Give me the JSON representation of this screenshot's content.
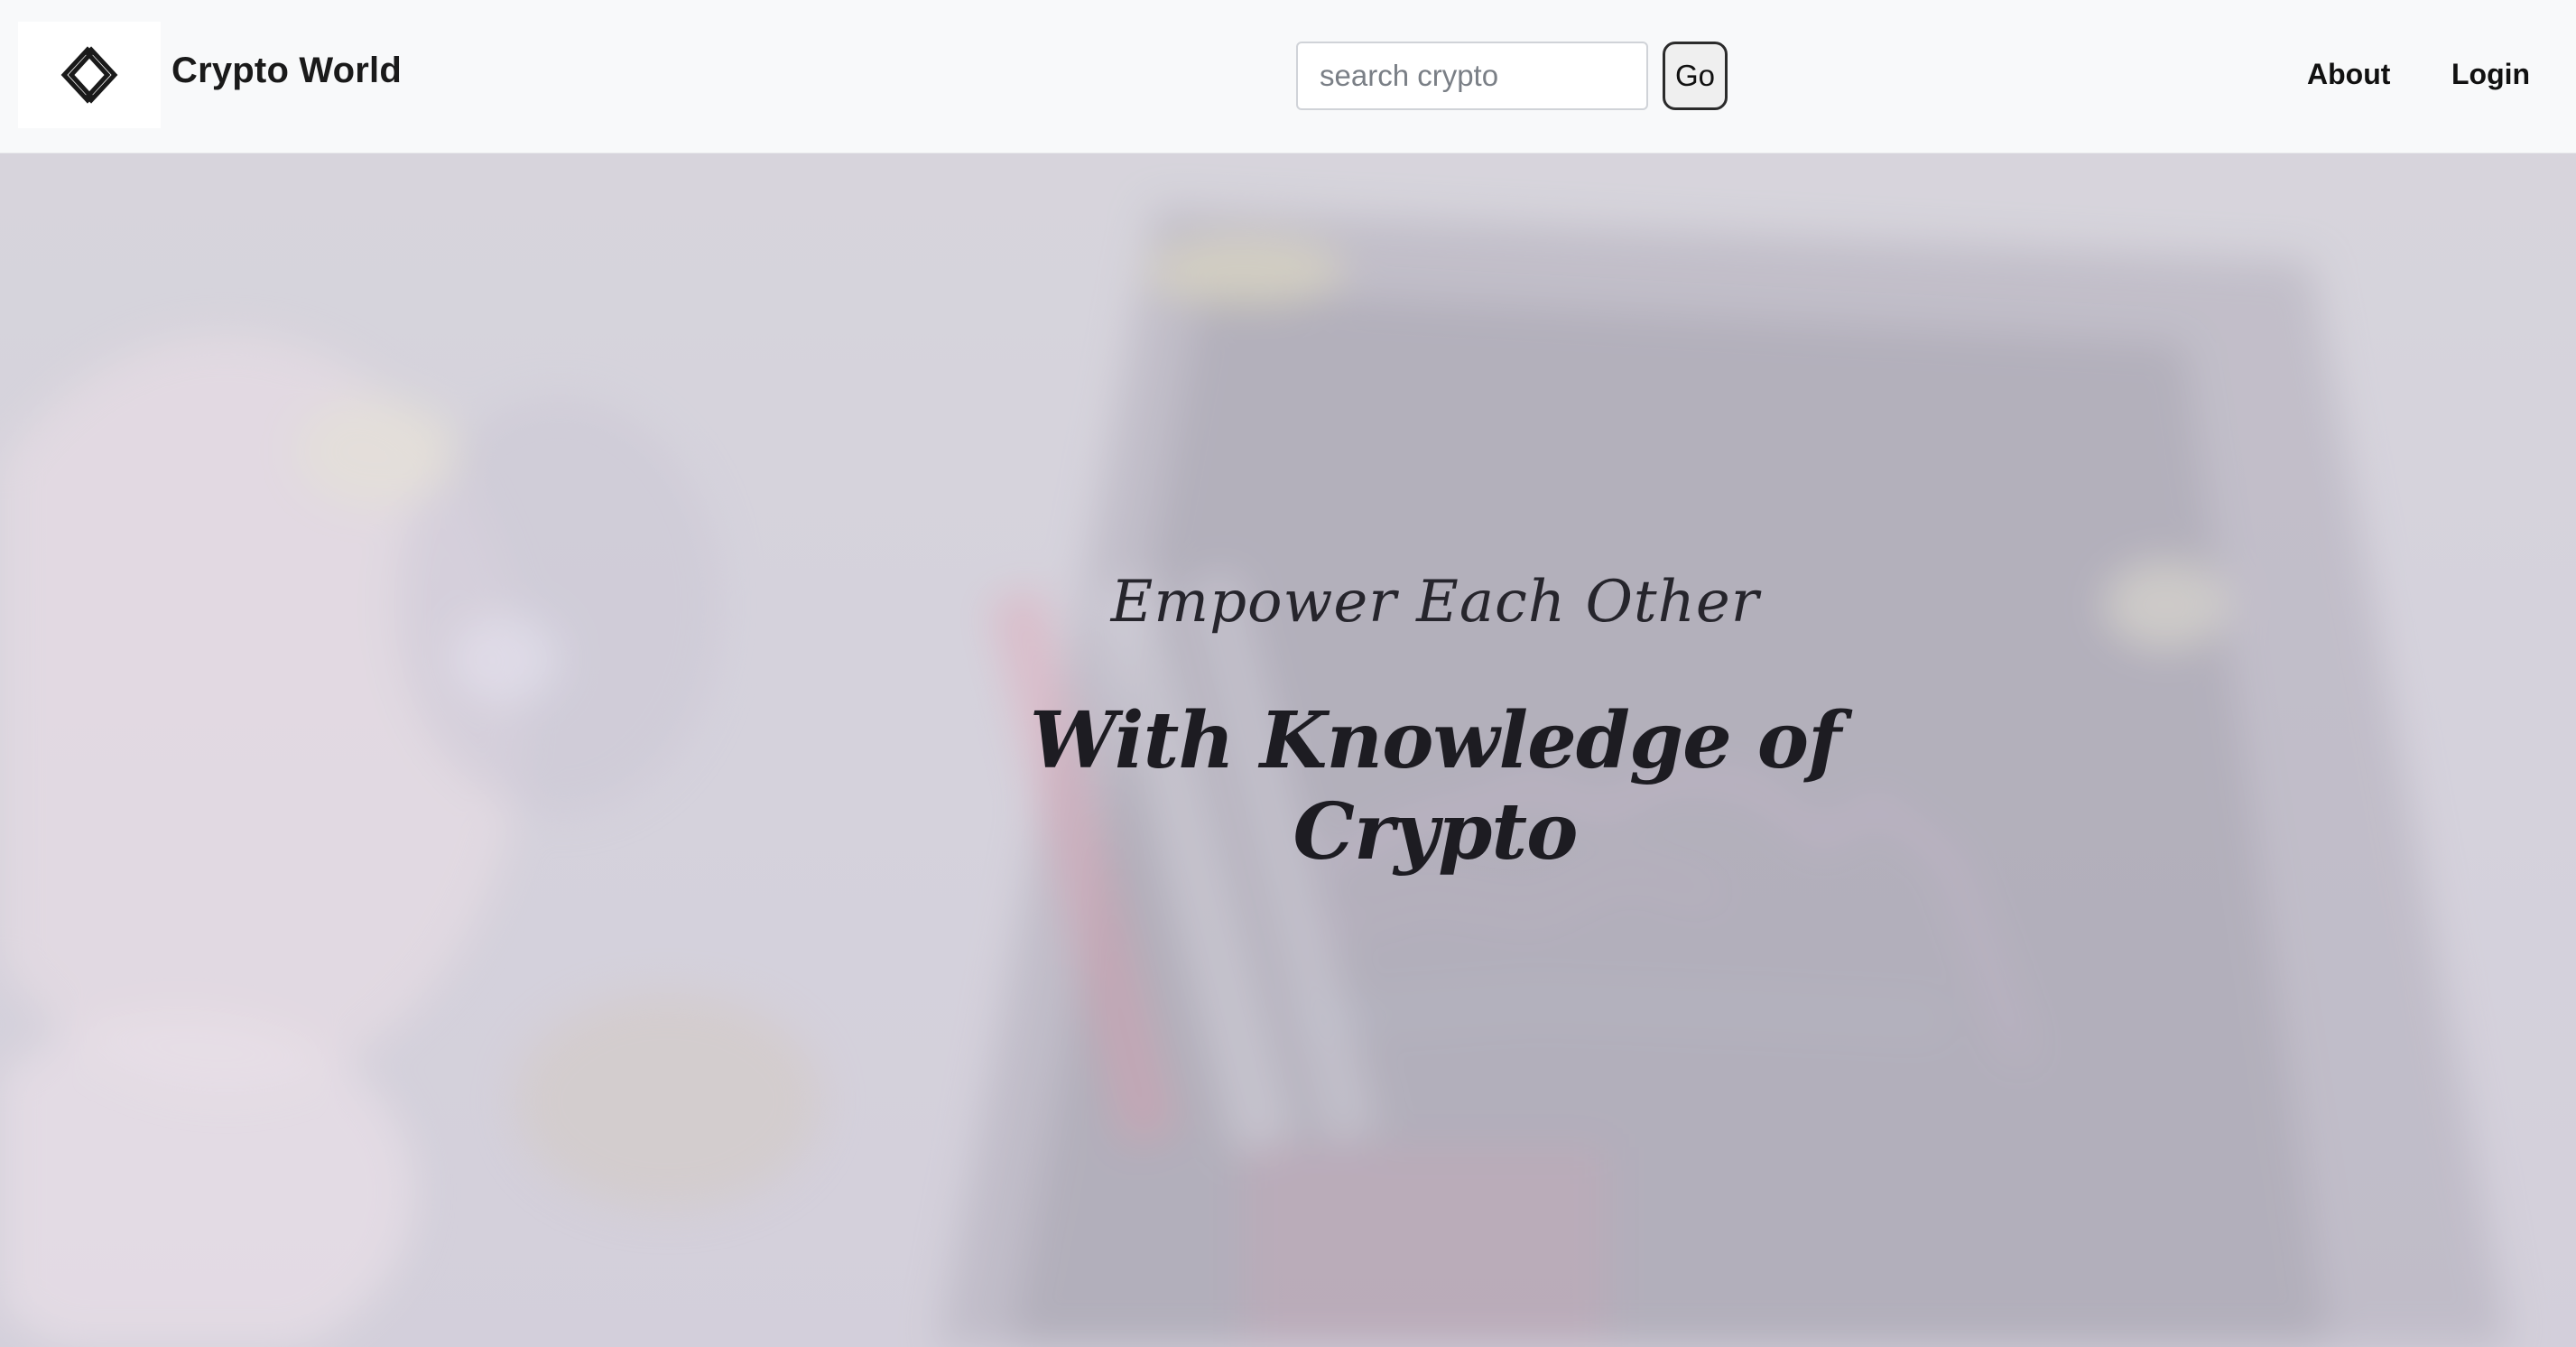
{
  "navbar": {
    "logo_icon": "diamond-logo-icon",
    "brand": "Crypto World",
    "search": {
      "placeholder": "search crypto",
      "value": ""
    },
    "go_label": "Go",
    "links": {
      "about": "About",
      "login": "Login"
    }
  },
  "hero": {
    "subtitle": "Empower Each Other",
    "title": "With Knowledge of Crypto"
  },
  "colors": {
    "navbar_bg": "#f8f9fa",
    "text_dark": "#111111",
    "hero_overlay": "#cdc9d2"
  }
}
